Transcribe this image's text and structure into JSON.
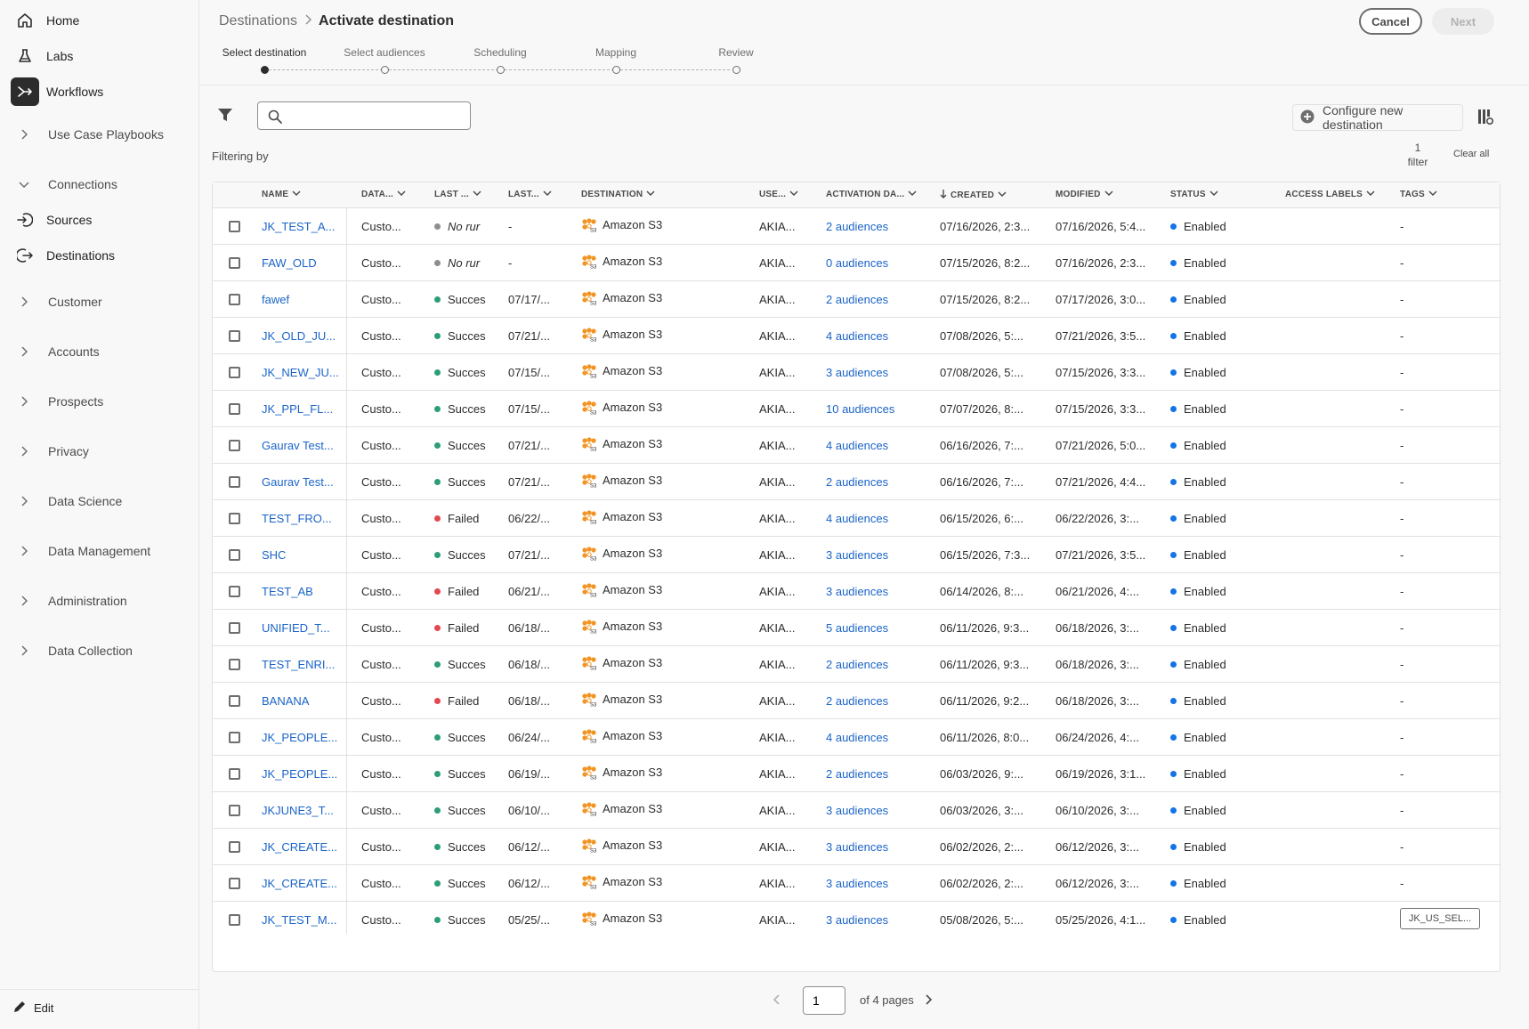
{
  "sidebar": {
    "items": [
      {
        "label": "Home",
        "icon": "home-icon"
      },
      {
        "label": "Labs",
        "icon": "flask-icon"
      },
      {
        "label": "Workflows",
        "icon": "workflow-icon"
      }
    ],
    "groups": [
      "Use Case Playbooks"
    ],
    "connections": {
      "label": "Connections",
      "children": [
        {
          "label": "Sources",
          "icon": "sign-in-icon"
        },
        {
          "label": "Destinations",
          "icon": "sign-out-icon"
        }
      ]
    },
    "more_groups": [
      "Customer",
      "Accounts",
      "Prospects",
      "Privacy",
      "Data Science",
      "Data Management",
      "Administration",
      "Data Collection"
    ],
    "edit_label": "Edit"
  },
  "header": {
    "breadcrumb_parent": "Destinations",
    "breadcrumb_current": "Activate destination",
    "cancel_label": "Cancel",
    "next_label": "Next"
  },
  "steps": [
    "Select destination",
    "Select audiences",
    "Scheduling",
    "Mapping",
    "Review"
  ],
  "toolbar": {
    "search_value": "",
    "configure_label": "Configure new destination",
    "filtering_by": "Filtering by",
    "filter_count": "1",
    "filter_word": "filter",
    "clear_all": "Clear all"
  },
  "table": {
    "columns": [
      "NAME",
      "DATA...",
      "LAST ...",
      "LAST...",
      "DESTINATION",
      "USE...",
      "ACTIVATION DA...",
      "CREATED",
      "MODIFIED",
      "STATUS",
      "ACCESS LABELS",
      "TAGS"
    ],
    "rows": [
      {
        "name": "JK_TEST_A...",
        "data": "Custo...",
        "run_status": "No rur",
        "run_state": "none",
        "last": "-",
        "dest": "Amazon S3",
        "use": "AKIA...",
        "act": "2 audiences",
        "created": "07/16/2026, 2:3...",
        "modified": "07/16/2026, 5:4...",
        "status": "Enabled",
        "tags": "-"
      },
      {
        "name": "FAW_OLD",
        "data": "Custo...",
        "run_status": "No rur",
        "run_state": "none",
        "last": "-",
        "dest": "Amazon S3",
        "use": "AKIA...",
        "act": "0 audiences",
        "created": "07/15/2026, 8:2...",
        "modified": "07/16/2026, 2:3...",
        "status": "Enabled",
        "tags": "-"
      },
      {
        "name": "fawef",
        "data": "Custo...",
        "run_status": "Succes",
        "run_state": "ok",
        "last": "07/17/...",
        "dest": "Amazon S3",
        "use": "AKIA...",
        "act": "2 audiences",
        "created": "07/15/2026, 8:2...",
        "modified": "07/17/2026, 3:0...",
        "status": "Enabled",
        "tags": "-"
      },
      {
        "name": "JK_OLD_JU...",
        "data": "Custo...",
        "run_status": "Succes",
        "run_state": "ok",
        "last": "07/21/...",
        "dest": "Amazon S3",
        "use": "AKIA...",
        "act": "4 audiences",
        "created": "07/08/2026, 5:...",
        "modified": "07/21/2026, 3:5...",
        "status": "Enabled",
        "tags": "-"
      },
      {
        "name": "JK_NEW_JU...",
        "data": "Custo...",
        "run_status": "Succes",
        "run_state": "ok",
        "last": "07/15/...",
        "dest": "Amazon S3",
        "use": "AKIA...",
        "act": "3 audiences",
        "created": "07/08/2026, 5:...",
        "modified": "07/15/2026, 3:3...",
        "status": "Enabled",
        "tags": "-"
      },
      {
        "name": "JK_PPL_FL...",
        "data": "Custo...",
        "run_status": "Succes",
        "run_state": "ok",
        "last": "07/15/...",
        "dest": "Amazon S3",
        "use": "AKIA...",
        "act": "10 audiences",
        "created": "07/07/2026, 8:...",
        "modified": "07/15/2026, 3:3...",
        "status": "Enabled",
        "tags": "-"
      },
      {
        "name": "Gaurav Test...",
        "data": "Custo...",
        "run_status": "Succes",
        "run_state": "ok",
        "last": "07/21/...",
        "dest": "Amazon S3",
        "use": "AKIA...",
        "act": "4 audiences",
        "created": "06/16/2026, 7:...",
        "modified": "07/21/2026, 5:0...",
        "status": "Enabled",
        "tags": "-"
      },
      {
        "name": "Gaurav Test...",
        "data": "Custo...",
        "run_status": "Succes",
        "run_state": "ok",
        "last": "07/21/...",
        "dest": "Amazon S3",
        "use": "AKIA...",
        "act": "2 audiences",
        "created": "06/16/2026, 7:...",
        "modified": "07/21/2026, 4:4...",
        "status": "Enabled",
        "tags": "-"
      },
      {
        "name": "TEST_FRO...",
        "data": "Custo...",
        "run_status": "Failed",
        "run_state": "fail",
        "last": "06/22/...",
        "dest": "Amazon S3",
        "use": "AKIA...",
        "act": "4 audiences",
        "created": "06/15/2026, 6:...",
        "modified": "06/22/2026, 3:...",
        "status": "Enabled",
        "tags": "-"
      },
      {
        "name": "SHC",
        "data": "Custo...",
        "run_status": "Succes",
        "run_state": "ok",
        "last": "07/21/...",
        "dest": "Amazon S3",
        "use": "AKIA...",
        "act": "3 audiences",
        "created": "06/15/2026, 7:3...",
        "modified": "07/21/2026, 3:5...",
        "status": "Enabled",
        "tags": "-"
      },
      {
        "name": "TEST_AB",
        "data": "Custo...",
        "run_status": "Failed",
        "run_state": "fail",
        "last": "06/21/...",
        "dest": "Amazon S3",
        "use": "AKIA...",
        "act": "3 audiences",
        "created": "06/14/2026, 8:...",
        "modified": "06/21/2026, 4:...",
        "status": "Enabled",
        "tags": "-"
      },
      {
        "name": "UNIFIED_T...",
        "data": "Custo...",
        "run_status": "Failed",
        "run_state": "fail",
        "last": "06/18/...",
        "dest": "Amazon S3",
        "use": "AKIA...",
        "act": "5 audiences",
        "created": "06/11/2026, 9:3...",
        "modified": "06/18/2026, 3:...",
        "status": "Enabled",
        "tags": "-"
      },
      {
        "name": "TEST_ENRI...",
        "data": "Custo...",
        "run_status": "Succes",
        "run_state": "ok",
        "last": "06/18/...",
        "dest": "Amazon S3",
        "use": "AKIA...",
        "act": "2 audiences",
        "created": "06/11/2026, 9:3...",
        "modified": "06/18/2026, 3:...",
        "status": "Enabled",
        "tags": "-"
      },
      {
        "name": "BANANA",
        "data": "Custo...",
        "run_status": "Failed",
        "run_state": "fail",
        "last": "06/18/...",
        "dest": "Amazon S3",
        "use": "AKIA...",
        "act": "2 audiences",
        "created": "06/11/2026, 9:2...",
        "modified": "06/18/2026, 3:...",
        "status": "Enabled",
        "tags": "-"
      },
      {
        "name": "JK_PEOPLE...",
        "data": "Custo...",
        "run_status": "Succes",
        "run_state": "ok",
        "last": "06/24/...",
        "dest": "Amazon S3",
        "use": "AKIA...",
        "act": "4 audiences",
        "created": "06/11/2026, 8:0...",
        "modified": "06/24/2026, 4:...",
        "status": "Enabled",
        "tags": "-"
      },
      {
        "name": "JK_PEOPLE...",
        "data": "Custo...",
        "run_status": "Succes",
        "run_state": "ok",
        "last": "06/19/...",
        "dest": "Amazon S3",
        "use": "AKIA...",
        "act": "2 audiences",
        "created": "06/03/2026, 9:...",
        "modified": "06/19/2026, 3:1...",
        "status": "Enabled",
        "tags": "-"
      },
      {
        "name": "JKJUNE3_T...",
        "data": "Custo...",
        "run_status": "Succes",
        "run_state": "ok",
        "last": "06/10/...",
        "dest": "Amazon S3",
        "use": "AKIA...",
        "act": "3 audiences",
        "created": "06/03/2026, 3:...",
        "modified": "06/10/2026, 3:...",
        "status": "Enabled",
        "tags": "-"
      },
      {
        "name": "JK_CREATE...",
        "data": "Custo...",
        "run_status": "Succes",
        "run_state": "ok",
        "last": "06/12/...",
        "dest": "Amazon S3",
        "use": "AKIA...",
        "act": "3 audiences",
        "created": "06/02/2026, 2:...",
        "modified": "06/12/2026, 3:...",
        "status": "Enabled",
        "tags": "-"
      },
      {
        "name": "JK_CREATE...",
        "data": "Custo...",
        "run_status": "Succes",
        "run_state": "ok",
        "last": "06/12/...",
        "dest": "Amazon S3",
        "use": "AKIA...",
        "act": "3 audiences",
        "created": "06/02/2026, 2:...",
        "modified": "06/12/2026, 3:...",
        "status": "Enabled",
        "tags": "-"
      },
      {
        "name": "JK_TEST_M...",
        "data": "Custo...",
        "run_status": "Succes",
        "run_state": "ok",
        "last": "05/25/...",
        "dest": "Amazon S3",
        "use": "AKIA...",
        "act": "3 audiences",
        "created": "05/08/2026, 5:...",
        "modified": "05/25/2026, 4:1...",
        "status": "Enabled",
        "tags": "JK_US_SEL...",
        "tag_chip": true
      }
    ]
  },
  "pagination": {
    "page": "1",
    "of_pages": "of 4 pages"
  },
  "colors": {
    "link": "#1b64c8",
    "success": "#2d9d78",
    "failed": "#e34850",
    "neutral": "#8e8e8e",
    "enabled": "#1473e6"
  }
}
